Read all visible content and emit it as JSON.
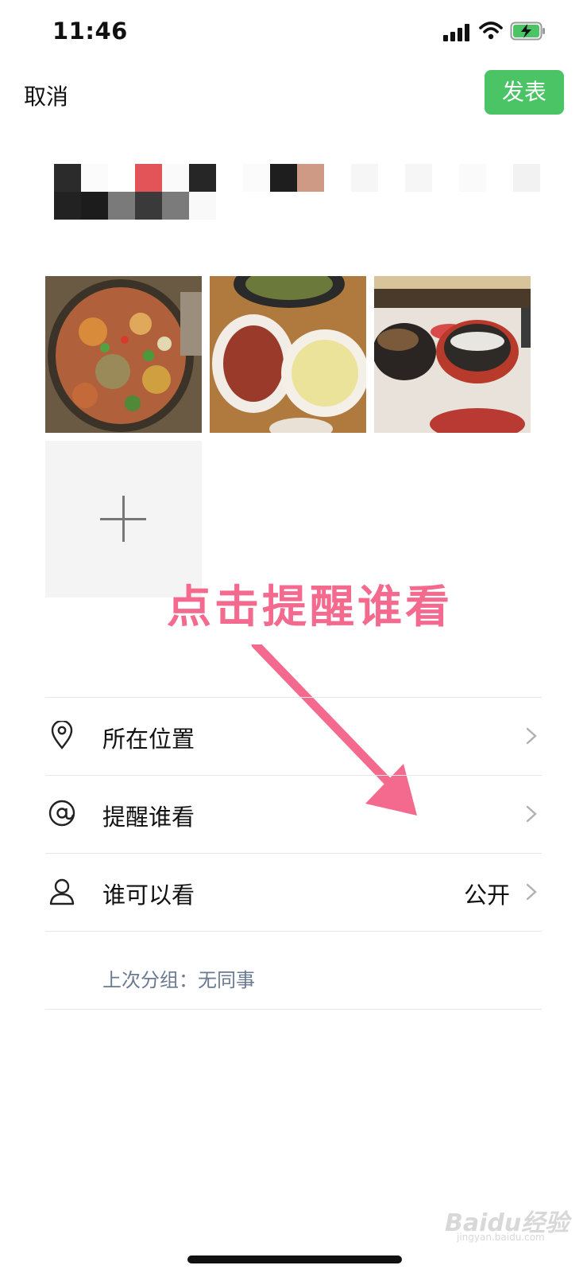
{
  "status": {
    "time": "11:46"
  },
  "toolbar": {
    "cancel_label": "取消",
    "publish_label": "发表"
  },
  "annotation": {
    "text": "点击提醒谁看"
  },
  "menu": {
    "location_label": "所在位置",
    "mention_label": "提醒谁看",
    "visibility_label": "谁可以看",
    "visibility_value": "公开",
    "last_group_text": "上次分组：无同事"
  },
  "watermark": {
    "main": "Baidu经验",
    "sub": "jingyan.baidu.com"
  },
  "colors": {
    "accent": "#4ac464",
    "annotation": "#f36a8e",
    "muted_text": "#6a7a93"
  },
  "icons": [
    "location-pin-icon",
    "at-sign-icon",
    "person-icon",
    "chevron-right-icon",
    "plus-icon",
    "wifi-icon",
    "battery-charging-icon",
    "cellular-signal-icon"
  ]
}
